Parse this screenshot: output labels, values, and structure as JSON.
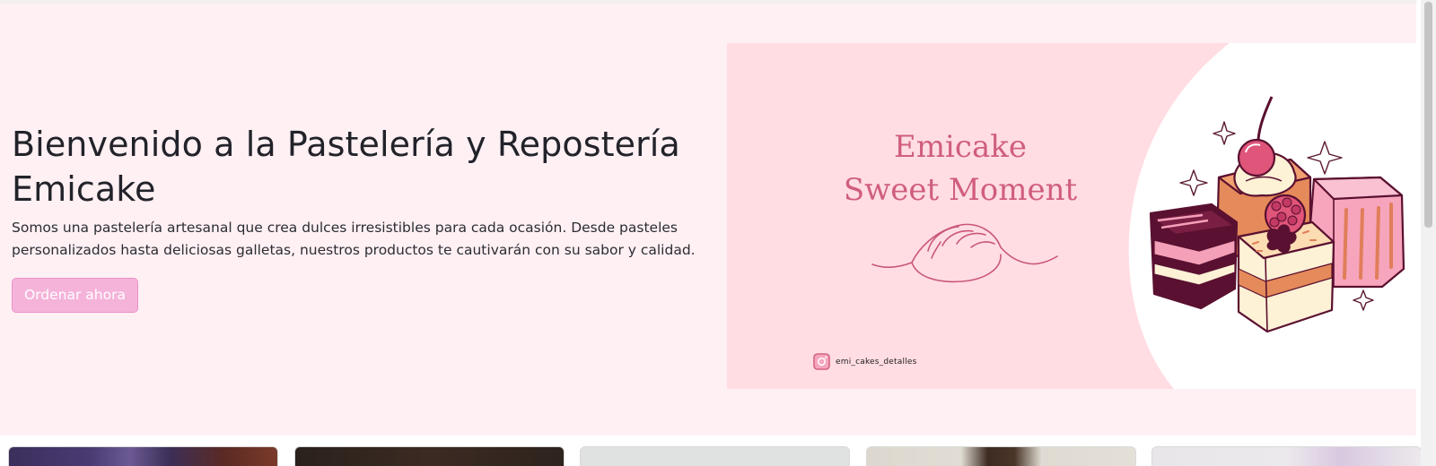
{
  "hero": {
    "title": "Bienvenido a la Pastelería y Repostería Emicake",
    "description": "Somos una pastelería artesanal que crea dulces irresistibles para cada ocasión. Desde pasteles personalizados hasta deliciosas galletas, nuestros productos te cautivarán con su sabor y calidad.",
    "order_button": "Ordenar ahora"
  },
  "banner": {
    "title_line1": "Emicake",
    "title_line2": "Sweet Moment",
    "instagram_handle": "emi_cakes_detalles"
  },
  "colors": {
    "hero_bg": "#fff0f3",
    "banner_bg": "#ffdde3",
    "brand_pink": "#d05e7d",
    "button_bg": "#f5b3da",
    "title_text": "#22232a"
  },
  "icons": {
    "instagram": "instagram-icon",
    "cake_illustration": "petit-fours-cake-illustration",
    "bread_outline": "bread-line-drawing",
    "sparkle": "sparkle-icon"
  }
}
